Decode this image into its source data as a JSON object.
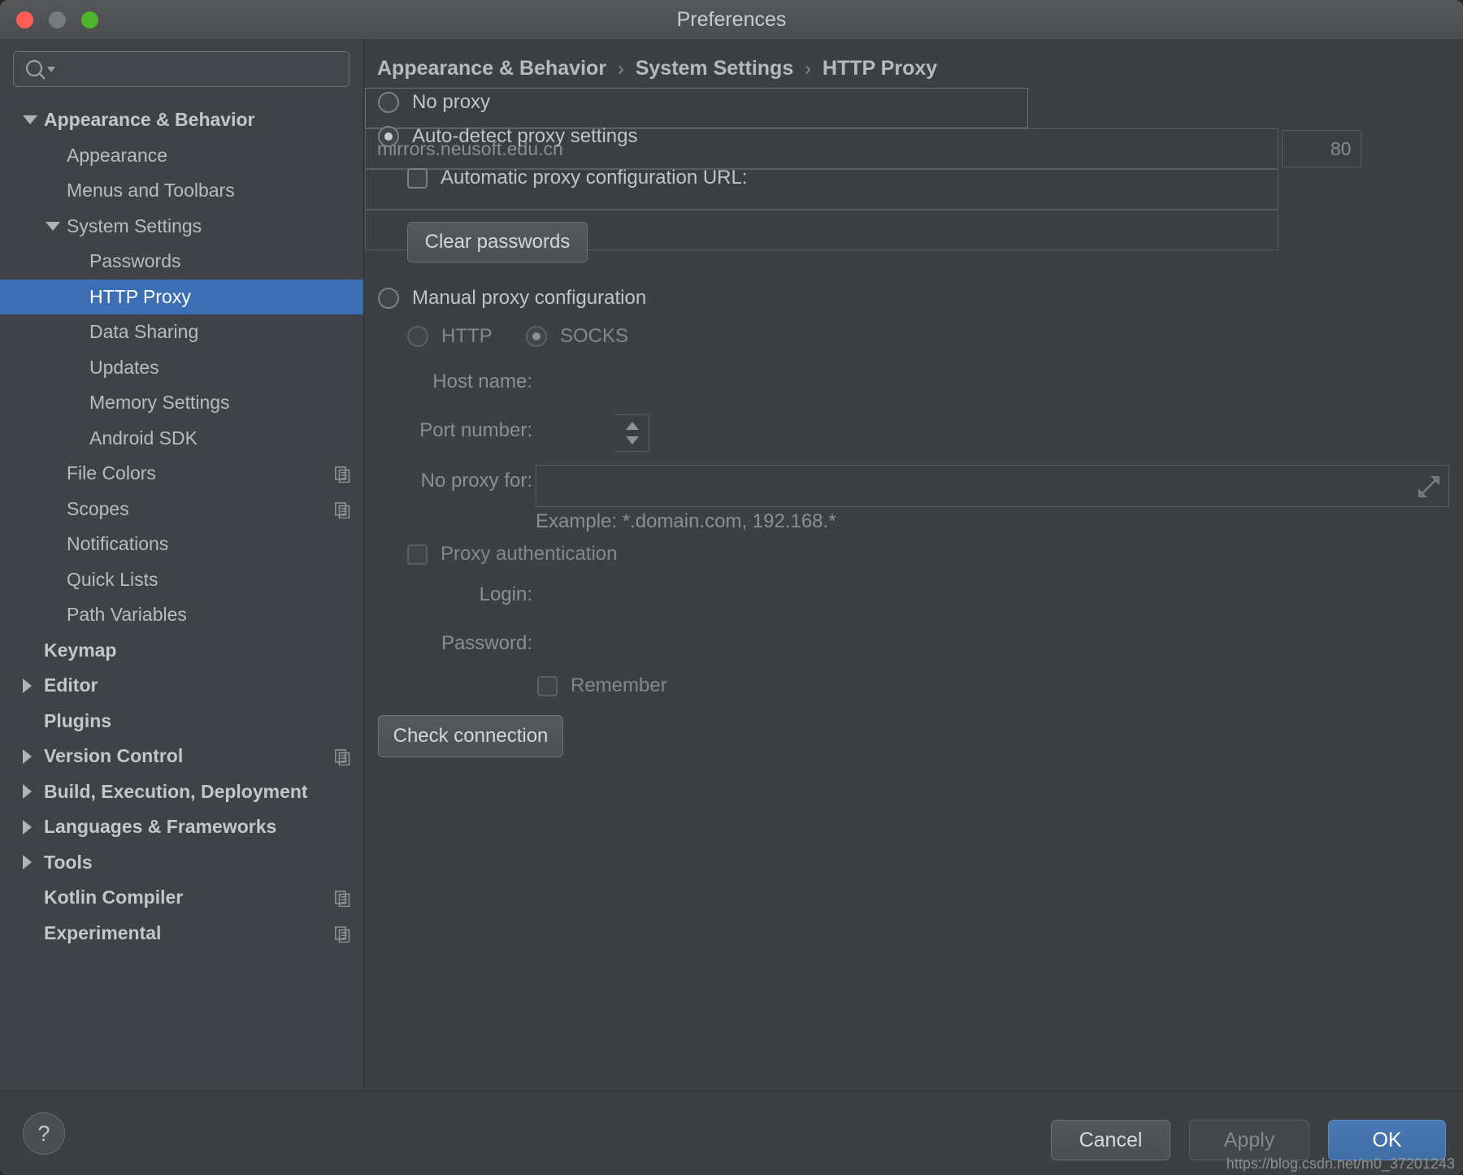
{
  "window": {
    "title": "Preferences",
    "traffic_lights": [
      "close",
      "minimize",
      "maximize"
    ]
  },
  "sidebar": {
    "search": {
      "value": "",
      "placeholder": ""
    },
    "items": [
      {
        "label": "Appearance & Behavior",
        "indent": 0,
        "twisty": "down",
        "bold": true,
        "selected": false,
        "copy": false
      },
      {
        "label": "Appearance",
        "indent": 1,
        "twisty": "none",
        "bold": false,
        "selected": false,
        "copy": false
      },
      {
        "label": "Menus and Toolbars",
        "indent": 1,
        "twisty": "none",
        "bold": false,
        "selected": false,
        "copy": false
      },
      {
        "label": "System Settings",
        "indent": 1,
        "twisty": "down",
        "bold": false,
        "selected": false,
        "copy": false
      },
      {
        "label": "Passwords",
        "indent": 2,
        "twisty": "none",
        "bold": false,
        "selected": false,
        "copy": false
      },
      {
        "label": "HTTP Proxy",
        "indent": 2,
        "twisty": "none",
        "bold": false,
        "selected": true,
        "copy": false
      },
      {
        "label": "Data Sharing",
        "indent": 2,
        "twisty": "none",
        "bold": false,
        "selected": false,
        "copy": false
      },
      {
        "label": "Updates",
        "indent": 2,
        "twisty": "none",
        "bold": false,
        "selected": false,
        "copy": false
      },
      {
        "label": "Memory Settings",
        "indent": 2,
        "twisty": "none",
        "bold": false,
        "selected": false,
        "copy": false
      },
      {
        "label": "Android SDK",
        "indent": 2,
        "twisty": "none",
        "bold": false,
        "selected": false,
        "copy": false
      },
      {
        "label": "File Colors",
        "indent": 1,
        "twisty": "none",
        "bold": false,
        "selected": false,
        "copy": true
      },
      {
        "label": "Scopes",
        "indent": 1,
        "twisty": "none",
        "bold": false,
        "selected": false,
        "copy": true
      },
      {
        "label": "Notifications",
        "indent": 1,
        "twisty": "none",
        "bold": false,
        "selected": false,
        "copy": false
      },
      {
        "label": "Quick Lists",
        "indent": 1,
        "twisty": "none",
        "bold": false,
        "selected": false,
        "copy": false
      },
      {
        "label": "Path Variables",
        "indent": 1,
        "twisty": "none",
        "bold": false,
        "selected": false,
        "copy": false
      },
      {
        "label": "Keymap",
        "indent": 0,
        "twisty": "none",
        "bold": true,
        "selected": false,
        "copy": false
      },
      {
        "label": "Editor",
        "indent": 0,
        "twisty": "right",
        "bold": true,
        "selected": false,
        "copy": false
      },
      {
        "label": "Plugins",
        "indent": 0,
        "twisty": "none",
        "bold": true,
        "selected": false,
        "copy": false
      },
      {
        "label": "Version Control",
        "indent": 0,
        "twisty": "right",
        "bold": true,
        "selected": false,
        "copy": true
      },
      {
        "label": "Build, Execution, Deployment",
        "indent": 0,
        "twisty": "right",
        "bold": true,
        "selected": false,
        "copy": false
      },
      {
        "label": "Languages & Frameworks",
        "indent": 0,
        "twisty": "right",
        "bold": true,
        "selected": false,
        "copy": false
      },
      {
        "label": "Tools",
        "indent": 0,
        "twisty": "right",
        "bold": true,
        "selected": false,
        "copy": false
      },
      {
        "label": "Kotlin Compiler",
        "indent": 0,
        "twisty": "none",
        "bold": true,
        "selected": false,
        "copy": true
      },
      {
        "label": "Experimental",
        "indent": 0,
        "twisty": "none",
        "bold": true,
        "selected": false,
        "copy": true
      }
    ]
  },
  "breadcrumb": {
    "level1": "Appearance & Behavior",
    "level2": "System Settings",
    "level3": "HTTP Proxy",
    "separator": "›"
  },
  "main": {
    "no_proxy": {
      "label": "No proxy",
      "checked": false
    },
    "auto_detect": {
      "label": "Auto-detect proxy settings",
      "checked": true
    },
    "auto_config_url": {
      "label": "Automatic proxy configuration URL:",
      "checked": false,
      "value": "",
      "placeholder": ""
    },
    "clear_passwords_button": "Clear passwords",
    "manual_proxy": {
      "label": "Manual proxy configuration",
      "checked": false
    },
    "protocol": {
      "http": {
        "label": "HTTP",
        "checked": false
      },
      "socks": {
        "label": "SOCKS",
        "checked": true
      }
    },
    "host_name": {
      "label": "Host name:",
      "value": "mirrors.neusoft.edu.cn",
      "placeholder": ""
    },
    "port_number": {
      "label": "Port number:",
      "value": "80"
    },
    "no_proxy_for": {
      "label": "No proxy for:",
      "value": "",
      "placeholder": ""
    },
    "example_hint": "Example: *.domain.com, 192.168.*",
    "proxy_auth": {
      "label": "Proxy authentication",
      "checked": false
    },
    "login": {
      "label": "Login:",
      "value": "",
      "placeholder": ""
    },
    "password": {
      "label": "Password:",
      "value": "",
      "placeholder": ""
    },
    "remember": {
      "label": "Remember",
      "checked": false
    },
    "check_connection_button": "Check connection"
  },
  "footer": {
    "help_label": "?",
    "cancel_label": "Cancel",
    "apply_label": "Apply",
    "ok_label": "OK",
    "watermark": "https://blog.csdn.net/m0_37201243"
  },
  "colors": {
    "accent_blue": "#3c6eb4",
    "ok_button": "#4a7ab5",
    "sidebar_bg": "#3f4347",
    "main_bg": "#3c4042"
  }
}
